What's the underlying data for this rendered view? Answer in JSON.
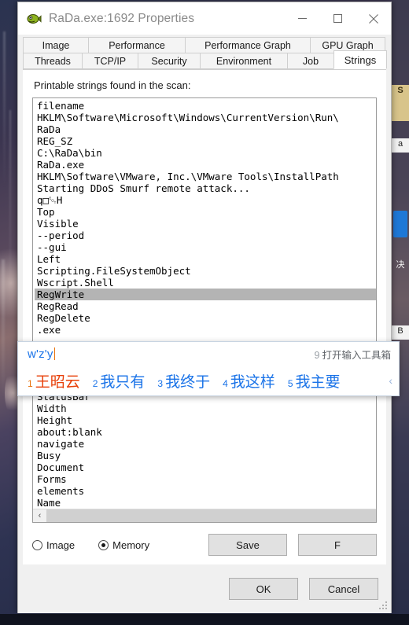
{
  "window": {
    "title": "RaDa.exe:1692 Properties",
    "icon": "process-explorer-fish-icon",
    "minimize_label": "—",
    "maximize_label": "□",
    "close_label": "✕"
  },
  "tabs": {
    "row1": [
      {
        "label": "Image",
        "active": false
      },
      {
        "label": "Performance",
        "active": false
      },
      {
        "label": "Performance Graph",
        "active": false
      },
      {
        "label": "GPU Graph",
        "active": false
      }
    ],
    "row2": [
      {
        "label": "Threads",
        "active": false
      },
      {
        "label": "TCP/IP",
        "active": false
      },
      {
        "label": "Security",
        "active": false
      },
      {
        "label": "Environment",
        "active": false
      },
      {
        "label": "Job",
        "active": false
      },
      {
        "label": "Strings",
        "active": true
      }
    ]
  },
  "page": {
    "label": "Printable strings found in the scan:",
    "strings": [
      {
        "text": "filename",
        "selected": false
      },
      {
        "text": "HKLM\\Software\\Microsoft\\Windows\\CurrentVersion\\Run\\",
        "selected": false
      },
      {
        "text": "RaDa",
        "selected": false
      },
      {
        "text": "REG_SZ",
        "selected": false
      },
      {
        "text": "C:\\RaDa\\bin",
        "selected": false
      },
      {
        "text": "RaDa.exe",
        "selected": false
      },
      {
        "text": "HKLM\\Software\\VMware, Inc.\\VMware Tools\\InstallPath",
        "selected": false
      },
      {
        "text": "Starting DDoS Smurf remote attack...",
        "selected": false
      },
      {
        "text": "q□␄H",
        "selected": false
      },
      {
        "text": "Top",
        "selected": false
      },
      {
        "text": "Visible",
        "selected": false
      },
      {
        "text": "--period",
        "selected": false
      },
      {
        "text": "--gui",
        "selected": false
      },
      {
        "text": "Left",
        "selected": false
      },
      {
        "text": "Scripting.FileSystemObject",
        "selected": false
      },
      {
        "text": "Wscript.Shell",
        "selected": false
      },
      {
        "text": "RegWrite",
        "selected": true
      },
      {
        "text": "RegRead",
        "selected": false
      },
      {
        "text": "RegDelete",
        "selected": false
      },
      {
        "text": ".exe",
        "selected": false
      }
    ],
    "strings_below": [
      {
        "text": "StatusBar",
        "selected": false
      },
      {
        "text": "Width",
        "selected": false
      },
      {
        "text": "Height",
        "selected": false
      },
      {
        "text": "about:blank",
        "selected": false
      },
      {
        "text": "navigate",
        "selected": false
      },
      {
        "text": "Busy",
        "selected": false
      },
      {
        "text": "Document",
        "selected": false
      },
      {
        "text": "Forms",
        "selected": false
      },
      {
        "text": "elements",
        "selected": false
      },
      {
        "text": "Name",
        "selected": false
      }
    ],
    "scroll_left_arrow": "‹"
  },
  "options": {
    "image_radio_label": "Image",
    "image_radio_selected": false,
    "memory_radio_label": "Memory",
    "memory_radio_selected": true,
    "save_label": "Save",
    "find_label": "F"
  },
  "footer": {
    "ok_label": "OK",
    "cancel_label": "Cancel"
  },
  "ime": {
    "composition": "w'z'y",
    "hint_number": "9",
    "hint_label": "打开输入工具箱",
    "next_page_arrow": "‹",
    "candidates": [
      {
        "index": "1",
        "text": "王昭云",
        "active": true
      },
      {
        "index": "2",
        "text": "我只有",
        "active": false
      },
      {
        "index": "3",
        "text": "我终于",
        "active": false
      },
      {
        "index": "4",
        "text": "我这样",
        "active": false
      },
      {
        "index": "5",
        "text": "我主要",
        "active": false
      }
    ]
  },
  "background": {
    "right_strip_labels": [
      "S",
      "a",
      "决",
      "B"
    ]
  },
  "colors": {
    "accent_blue": "#1a73e8",
    "accent_orange": "#e8400a",
    "selection_gray": "#b4b4b4",
    "window_bg": "#f0f0f0"
  }
}
